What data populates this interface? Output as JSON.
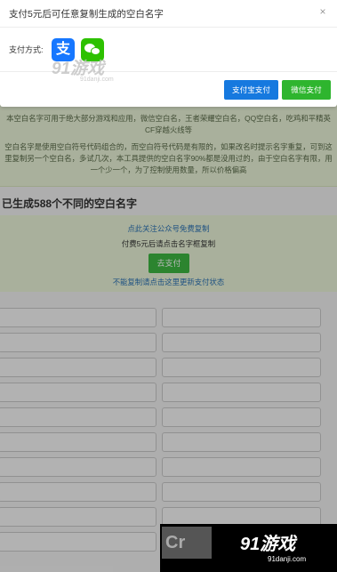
{
  "modal": {
    "title": "支付5元后可任意复制生成的空白名字",
    "close": "×",
    "pay_label": "支付方式:",
    "alipay_glyph": "支",
    "alipay_button": "支付宝支付",
    "wechat_button": "微信支付"
  },
  "info": {
    "p1": "本空白名字可用于绝大部分游戏和应用，微信空白名，王者荣耀空白名，QQ空白名，吃鸡和平精英CF穿越火线等",
    "p2": "空白名字是使用空白符号代码组合的，而空白符号代码是有限的，如果改名时提示名字重复，可到这里复制另一个空白名，多试几次，本工具提供的空白名字90%都是没用过的，由于空白名字有限，用一个少一个，为了控制使用数量，所以价格偏高"
  },
  "generated": {
    "prefix": "已生成",
    "count": "588",
    "suffix": "个不同的空白名字"
  },
  "pay_panel": {
    "follow_link": "点此关注公众号免费复制",
    "instruction": "付费5元后请点击名字框复制",
    "go_pay_button": "去支付",
    "refresh_link": "不能复制请点击这里更新支付状态"
  },
  "watermark": {
    "top_logo": "91游戏",
    "top_url": "91danji.com",
    "bottom_badge": "Cr",
    "bottom_logo": "91游戏",
    "bottom_url": "91danji.com"
  },
  "colors": {
    "alipay_blue": "#1679df",
    "wechat_green": "#2eb52e",
    "panel_green": "#eaf4d8",
    "link_blue": "#2c72b5"
  }
}
